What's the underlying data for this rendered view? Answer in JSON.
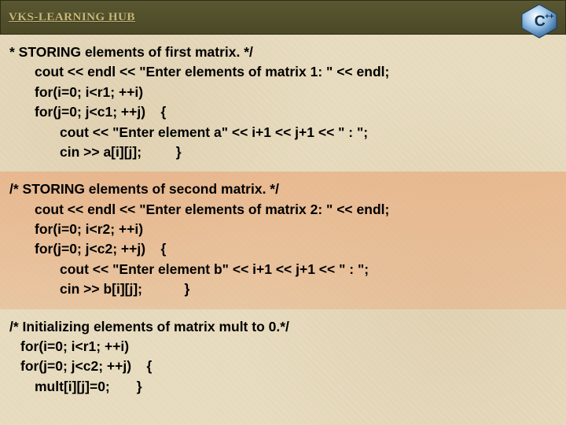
{
  "header": {
    "title": "VKS-LEARNING HUB",
    "logo": "cpp-logo-icon"
  },
  "blocks": {
    "b1": {
      "l1": "* STORING elements of first matrix. */",
      "l2": "cout << endl << \"Enter elements of matrix 1: \" << endl;",
      "l3": "for(i=0; i<r1; ++i)",
      "l4": "for(j=0; j<c1; ++j)    {",
      "l5": "cout << \"Enter element a\" << i+1 << j+1 << \" : \";",
      "l6": "cin >> a[i][j];         }"
    },
    "b2": {
      "l1": "/* STORING elements of second matrix. */",
      "l2": "cout << endl << \"Enter elements of matrix 2: \" << endl;",
      "l3": "for(i=0; i<r2; ++i)",
      "l4": "for(j=0; j<c2; ++j)    {",
      "l5": "cout << \"Enter element b\" << i+1 << j+1 << \" : \";",
      "l6": "cin >> b[i][j];           }"
    },
    "b3": {
      "l1": "/* Initializing elements of matrix mult to 0.*/",
      "l2": "for(i=0; i<r1; ++i)",
      "l3": "for(j=0; j<c2; ++j)    {",
      "l4": "mult[i][j]=0;       }"
    }
  }
}
